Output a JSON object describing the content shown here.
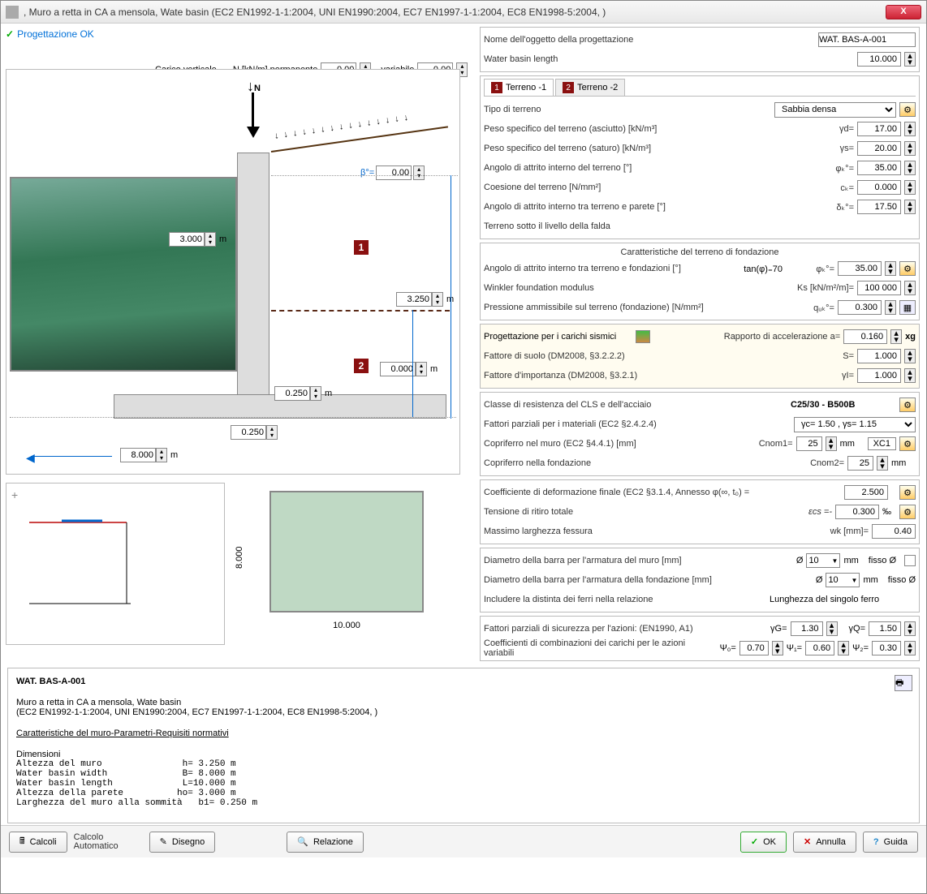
{
  "window": {
    "title": ", Muro a retta in CA a mensola, Wate basin (EC2 EN1992-1-1:2004, UNI EN1990:2004, EC7 EN1997-1-1:2004, EC8 EN1998-5:2004, )",
    "close": "X"
  },
  "status": "Progettazione OK",
  "diagram": {
    "carico_label": "Carico verticale",
    "n_label": "N [kN/m] permanente",
    "n_perm": "0.00",
    "var_label": "variabile",
    "n_var": "0.00",
    "N_arrow": "N",
    "beta_label": "β°=",
    "beta": "0.00",
    "h_wall": "3.000",
    "h_total": "3.250",
    "h_water": "0.000",
    "t_foot": "0.250",
    "t_stem": "0.250",
    "b_foot": "8.000",
    "unit_m": "m",
    "marker1": "1",
    "marker2": "2"
  },
  "lower": {
    "length": "10.000",
    "height": "8.000",
    "zoom": "+"
  },
  "header": {
    "name_label": "Nome dell'oggetto della progettazione",
    "name_value": "WAT. BAS-A-001",
    "length_label": "Water basin length",
    "length_value": "10.000"
  },
  "tabs": {
    "t1": "Terreno -1",
    "t2": "Terreno -2"
  },
  "soil": {
    "tipo_label": "Tipo di terreno",
    "tipo_value": "Sabbia densa",
    "peso_dry_label": "Peso specifico del terreno (asciutto) [kN/m³]",
    "peso_dry_sym": "γd=",
    "peso_dry": "17.00",
    "peso_sat_label": "Peso specifico del terreno (saturo) [kN/m³]",
    "peso_sat_sym": "γs=",
    "peso_sat": "20.00",
    "phi_label": "Angolo di attrito interno del terreno [°]",
    "phi_sym": "φₖ°=",
    "phi": "35.00",
    "coes_label": "Coesione del terreno [N/mm²]",
    "coes_sym": "cₖ=",
    "coes": "0.000",
    "delta_label": "Angolo di attrito interno tra terreno e parete [°]",
    "delta_sym": "δₖ°=",
    "delta": "17.50",
    "falda_label": "Terreno sotto il livello della falda"
  },
  "foundation": {
    "title": "Caratteristiche del terreno di fondazione",
    "phi_f_label": "Angolo di attrito interno tra terreno e fondazioni [°]",
    "tan_label": "tan(φ)₌70",
    "phi_f_sym": "φₖ°=",
    "phi_f": "35.00",
    "winkler_label": "Winkler foundation modulus",
    "winkler_sym": "Ks [kN/m²/m]=",
    "winkler": "100 000",
    "press_label": "Pressione ammissibile sul terreno (fondazione) [N/mm²]",
    "press_sym": "qᵤₖ°=",
    "press": "0.300"
  },
  "seismic": {
    "title": "Progettazione per i carichi sismici",
    "ratio_label": "Rapporto di accelerazione a=",
    "ratio": "0.160",
    "xg": "xg",
    "suolo_label": "Fattore di suolo (DM2008, §3.2.2.2)",
    "suolo_sym": "S=",
    "suolo": "1.000",
    "imp_label": "Fattore d'importanza (DM2008, §3.2.1)",
    "imp_sym": "γI=",
    "imp": "1.000"
  },
  "materials": {
    "class_label": "Classe di resistenza del CLS e dell'acciaio",
    "class_value": "C25/30 - B500B",
    "partial_label": "Fattori parziali per i materiali (EC2 §2.4.2.4)",
    "partial_value": "γc= 1.50 , γs=  1.15",
    "cover_wall_label": "Copriferro nel muro (EC2 §4.4.1) [mm]",
    "cover_wall_sym": "Cnom1=",
    "cover_wall": "25",
    "mm": "mm",
    "xc1": "XC1",
    "cover_found_label": "Copriferro nella fondazione",
    "cover_found_sym": "Cnom2=",
    "cover_found": "25"
  },
  "deform": {
    "coef_label": "Coefficiente di deformazione finale (EC2 §3.1.4, Annesso φ(∞, t₀) =",
    "coef": "2.500",
    "ritiro_label": "Tensione di ritiro totale",
    "ritiro_sym": "εcs =-",
    "ritiro": "0.300",
    "permille": "‰",
    "crack_label": "Massimo larghezza fessura",
    "crack_sym": "wk [mm]=",
    "crack": "0.40"
  },
  "rebar": {
    "wall_label": "Diametro della barra per l'armatura del muro [mm]",
    "found_label": "Diametro della barra per l'armatura della fondazione [mm]",
    "diam_sym": "Ø",
    "diam": "10",
    "mm": "mm",
    "fisso": "fisso Ø",
    "include_label": "Includere la distinta dei ferri nella relazione",
    "length_label": "Lunghezza del singolo ferro"
  },
  "safety": {
    "partial_label": "Fattori parziali di sicurezza per l'azioni: (EN1990, A1)",
    "gG_sym": "γG=",
    "gG": "1.30",
    "gQ_sym": "γQ=",
    "gQ": "1.50",
    "comb_label": "Coefficienti di combinazioni dei carichi per le azioni variabili",
    "psi0_sym": "Ψ₀=",
    "psi0": "0.70",
    "psi1_sym": "Ψ₁=",
    "psi1": "0.60",
    "psi2_sym": "Ψ₂=",
    "psi2": "0.30"
  },
  "report": {
    "name": "WAT. BAS-A-001",
    "desc": "Muro a retta in CA a mensola, Wate basin",
    "codes": "(EC2 EN1992-1-1:2004, UNI EN1990:2004, EC7 EN1997-1-1:2004, EC8 EN1998-5:2004, )",
    "section": "Caratteristiche del muro-Parametri-Requisiti normativi",
    "l0": "Dimensioni",
    "l1": "Altezza del muro               h= 3.250 m",
    "l2": "Water basin width              B= 8.000 m",
    "l3": "Water basin length             L=10.000 m",
    "l4": "Altezza della parete          ho= 3.000 m",
    "l5": "Larghezza del muro alla sommità   b1= 0.250 m"
  },
  "buttons": {
    "calcoli": "Calcoli",
    "auto1": "Calcolo",
    "auto2": "Automatico",
    "disegno": "Disegno",
    "relazione": "Relazione",
    "ok": "OK",
    "annulla": "Annulla",
    "guida": "Guida"
  }
}
